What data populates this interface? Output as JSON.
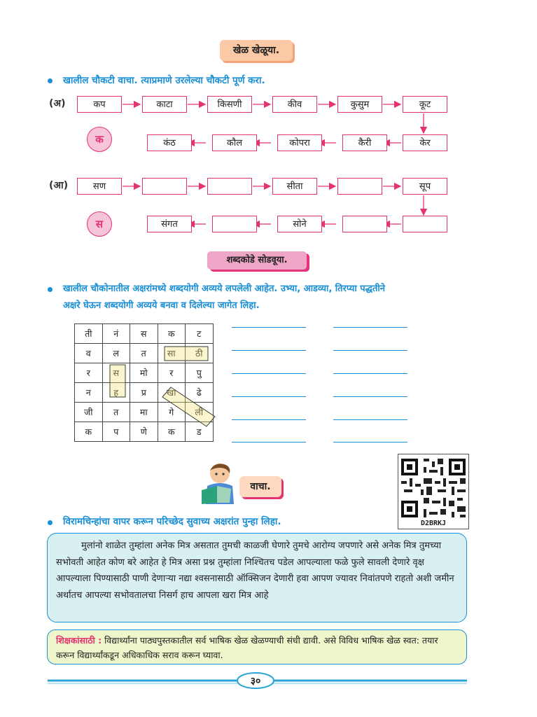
{
  "section1": {
    "header": "खेळ खेळूया.",
    "instruction": "खालील चौकटी वाचा. त्याप्रमाणे उरलेल्या चौकटी पूर्ण करा.",
    "a": {
      "label": "(अ)",
      "circle": "क",
      "top_row": [
        "कप",
        "काटा",
        "किसणी",
        "कीव",
        "कुसुम",
        "कूट"
      ],
      "bottom_row": [
        "कंठ",
        "कौल",
        "कोपरा",
        "कैरी",
        "केर"
      ]
    },
    "aa": {
      "label": "(आ)",
      "circle": "स",
      "top_row": [
        "सण",
        "",
        "",
        "सीता",
        "",
        "सूप"
      ],
      "bottom_row": [
        "संगत",
        "",
        "सोने",
        "",
        ""
      ]
    }
  },
  "section2": {
    "header": "शब्दकोडे सोडवूया.",
    "instruction_line1": "खालील चौकोनातील अक्षरांमध्ये शब्दयोगी अव्यये लपलेली आहेत. उभ्या, आडव्या, तिरप्या पद्धतीने",
    "instruction_line2": "अक्षरे घेऊन शब्दयोगी अव्यये बनवा व दिलेल्या जागेत लिहा.",
    "grid": [
      [
        "ती",
        "नं",
        "स",
        "क",
        "ट"
      ],
      [
        "व",
        "ल",
        "त",
        "सा",
        "ठी"
      ],
      [
        "र",
        "स",
        "मो",
        "र",
        "पु"
      ],
      [
        "न",
        "ह",
        "प्र",
        "खा",
        "ढे"
      ],
      [
        "जी",
        "त",
        "मा",
        "गे",
        "ली"
      ],
      [
        "क",
        "प",
        "णे",
        "क",
        "ड"
      ]
    ]
  },
  "section3": {
    "header": "वाचा.",
    "qr_code": "D2BRKJ",
    "instruction": "विरामचिन्हांचा वापर करून परिच्छेद सुवाच्य अक्षरांत पुन्हा लिहा.",
    "paragraph": "मुलांनो शाळेत तुम्हांला अनेक मित्र असतात तुमची काळजी घेणारे तुमचे आरोग्य जपणारे असे अनेक मित्र तुमच्या सभोवती आहेत कोण बरे आहेत हे मित्र असा प्रश्न तुम्हांला निश्चितच पडेल आपल्याला फळे फुले सावली देणारे वृक्ष आपल्याला पिण्यासाठी पाणी देणाऱ्या नद्या श्वसनासाठी ऑक्सिजन देणारी हवा आपण ज्यावर निवांतपणे राहतो अशी जमीन अर्थातच आपल्या सभोवतालचा निसर्ग हाच आपला खरा मित्र आहे"
  },
  "teacher_note": {
    "label": "शिक्षकांसाठी :",
    "text": "विद्यार्थ्यांना पाठ्यपुस्तकातील सर्व भाषिक खेळ खेळण्याची संधी द्यावी. असे विविध भाषिक खेळ स्वत: तयार करून विद्यार्थ्यांकडून अधिकाधिक सराव करून घ्यावा."
  },
  "page_number": "३०",
  "colors": {
    "accent": "#1a8fd6",
    "pink": "#e5336f",
    "header_peach": "#fbc9a6"
  }
}
